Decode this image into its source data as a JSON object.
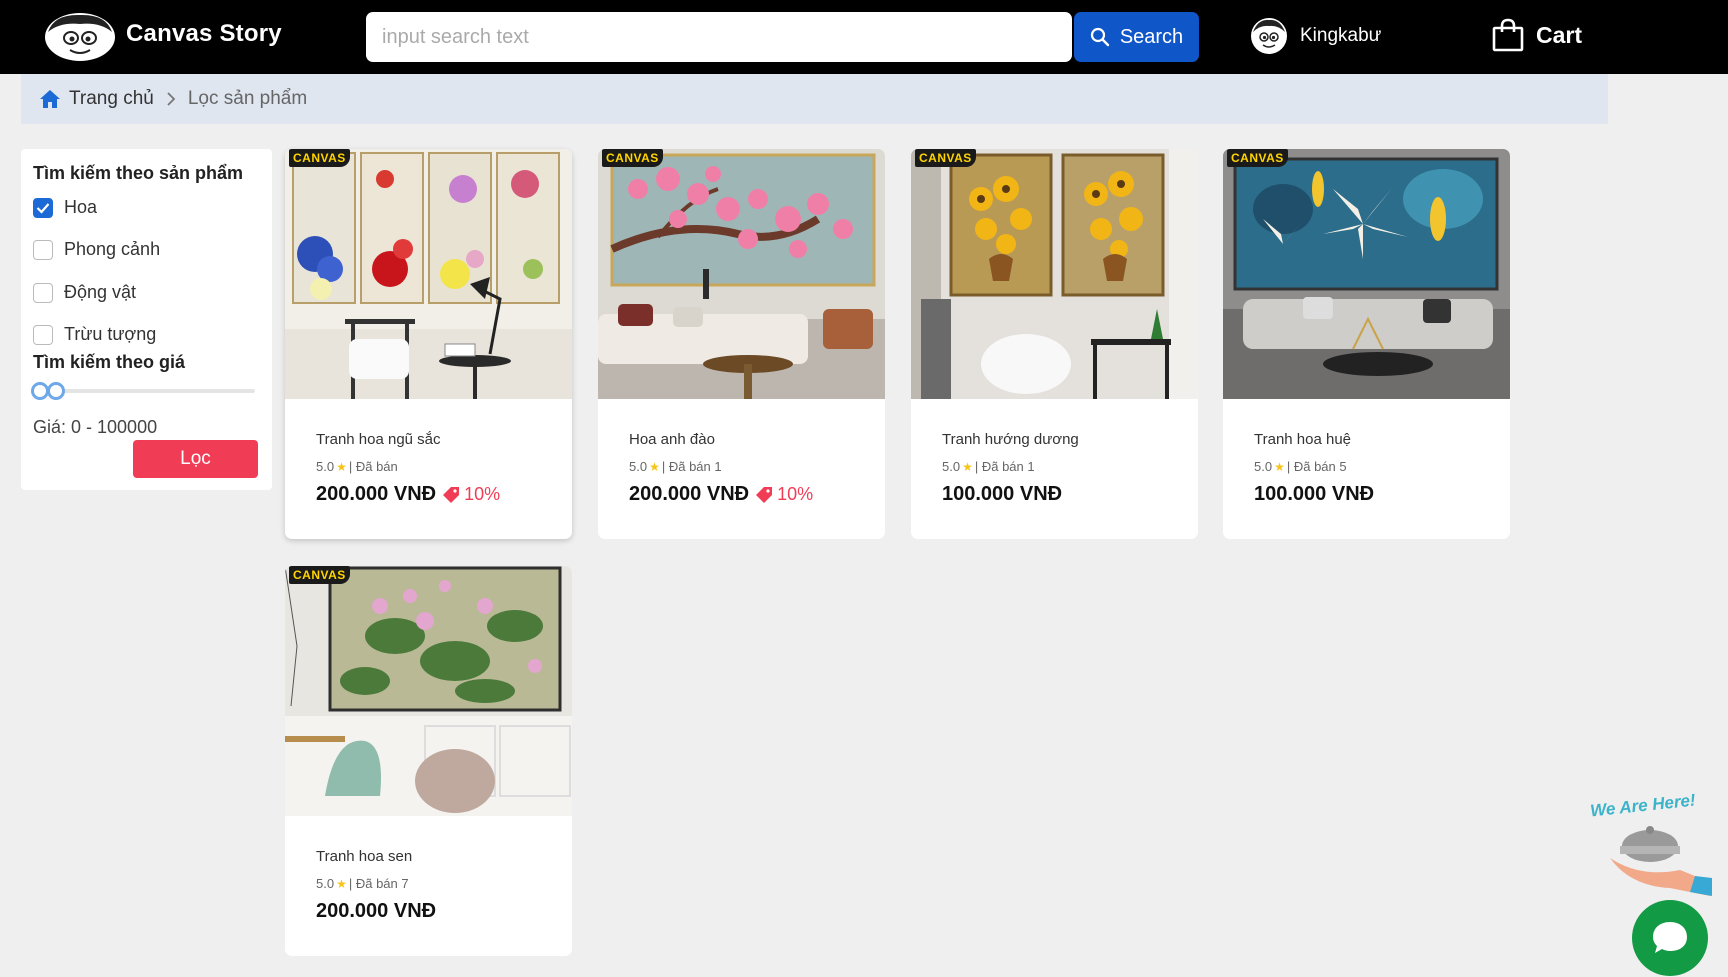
{
  "header": {
    "brand": "Canvas Story",
    "search_placeholder": "input search text",
    "search_button": "Search",
    "username": "Kingkabư",
    "cart_label": "Cart"
  },
  "breadcrumb": {
    "home": "Trang chủ",
    "current": "Lọc sản phẩm"
  },
  "filter": {
    "title_product": "Tìm kiếm theo sản phẩm",
    "categories": [
      {
        "label": "Hoa",
        "checked": true
      },
      {
        "label": "Phong cảnh",
        "checked": false
      },
      {
        "label": "Động vật",
        "checked": false
      },
      {
        "label": "Trừu tượng",
        "checked": false
      }
    ],
    "title_price": "Tìm kiếm theo giá",
    "price_range": "Giá: 0 - 100000",
    "filter_button": "Lọc"
  },
  "products": [
    {
      "name": "Tranh hoa ngũ sắc",
      "rating": "5.0",
      "sold": "| Đã bán",
      "price": "200.000 VNĐ",
      "discount": "10%"
    },
    {
      "name": "Hoa anh đào",
      "rating": "5.0",
      "sold": "| Đã bán 1",
      "price": "200.000 VNĐ",
      "discount": "10%"
    },
    {
      "name": "Tranh hướng dương",
      "rating": "5.0",
      "sold": "| Đã bán 1",
      "price": "100.000 VNĐ",
      "discount": ""
    },
    {
      "name": "Tranh hoa huệ",
      "rating": "5.0",
      "sold": "| Đã bán 5",
      "price": "100.000 VNĐ",
      "discount": ""
    },
    {
      "name": "Tranh hoa sen",
      "rating": "5.0",
      "sold": "| Đã bán 7",
      "price": "200.000 VNĐ",
      "discount": ""
    }
  ],
  "badge_text": "CANVAS",
  "chat": {
    "tagline": "We Are Here!"
  },
  "colors": {
    "header_bg": "#000000",
    "search_button": "#0f56c8",
    "accent_red": "#f03d55",
    "checkbox_blue": "#1c6ad6",
    "chat_green": "#139a44"
  }
}
